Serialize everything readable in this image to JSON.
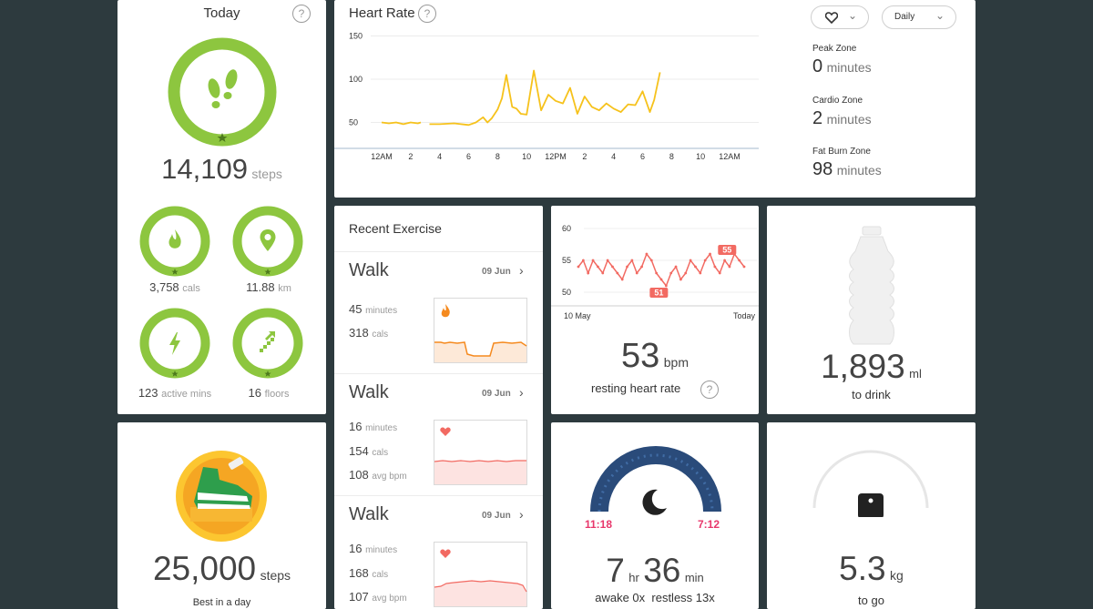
{
  "today": {
    "title": "Today",
    "help": "?",
    "steps_value": "14,109",
    "steps_unit": "steps",
    "cals_value": "3,758",
    "cals_unit": "cals",
    "km_value": "11.88",
    "km_unit": "km",
    "active_value": "123",
    "active_unit": "active mins",
    "floors_value": "16",
    "floors_unit": "floors"
  },
  "heart_rate": {
    "title": "Heart Rate",
    "help": "?",
    "period": "Daily",
    "zones": [
      {
        "label": "Peak Zone",
        "value": "0",
        "unit": "minutes"
      },
      {
        "label": "Cardio Zone",
        "value": "2",
        "unit": "minutes"
      },
      {
        "label": "Fat Burn Zone",
        "value": "98",
        "unit": "minutes"
      }
    ]
  },
  "chart_data": [
    {
      "type": "line",
      "x_tick_labels": [
        "12AM",
        "2",
        "4",
        "6",
        "8",
        "10",
        "12PM",
        "2",
        "4",
        "6",
        "8",
        "10",
        "12AM"
      ],
      "y_tick_labels": [
        "150",
        "100",
        "50"
      ],
      "ylim": [
        20,
        160
      ],
      "grid": true,
      "color": "#f6c21c",
      "series": [
        {
          "x": [
            0,
            0.5,
            1,
            1.5,
            2,
            2.5,
            2.7
          ],
          "y": [
            50,
            49,
            50,
            48,
            50,
            49,
            50
          ]
        },
        {
          "x": [
            3.3,
            4,
            5,
            6,
            6.5,
            7,
            7.3,
            7.6,
            8,
            8.3,
            8.6,
            9,
            9.3,
            9.6,
            10,
            10.5,
            11,
            11.5,
            12,
            12.5,
            13,
            13.5,
            14,
            14.5,
            15,
            15.5,
            16,
            16.5,
            17,
            17.5,
            18,
            18.5,
            18.8,
            19.2
          ],
          "y": [
            48,
            48,
            49,
            47,
            50,
            56,
            50,
            55,
            65,
            78,
            105,
            68,
            66,
            60,
            59,
            110,
            64,
            82,
            75,
            72,
            90,
            60,
            80,
            68,
            64,
            72,
            66,
            62,
            71,
            70,
            86,
            62,
            76,
            108
          ]
        }
      ]
    },
    {
      "type": "line",
      "x_tick_labels": [
        "10 May",
        "Today"
      ],
      "y_tick_labels": [
        "60",
        "55",
        "50"
      ],
      "ylim": [
        48,
        62
      ],
      "color": "#f26a62",
      "values": [
        54,
        55,
        53,
        55,
        54,
        53,
        55,
        54,
        53,
        52,
        54,
        55,
        53,
        54,
        56,
        55,
        53,
        52,
        51,
        53,
        54,
        52,
        53,
        55,
        54,
        53,
        55,
        56,
        54,
        53,
        55,
        54,
        56,
        55,
        54
      ],
      "annotations": [
        {
          "label": "51"
        },
        {
          "label": "55"
        }
      ]
    }
  ],
  "recent_exercise": {
    "title": "Recent Exercise",
    "items": [
      {
        "name": "Walk",
        "date": "09 Jun",
        "stats": [
          {
            "v": "45",
            "u": "minutes"
          },
          {
            "v": "318",
            "u": "cals"
          }
        ],
        "icon": "flame-icon"
      },
      {
        "name": "Walk",
        "date": "09 Jun",
        "stats": [
          {
            "v": "16",
            "u": "minutes"
          },
          {
            "v": "154",
            "u": "cals"
          },
          {
            "v": "108",
            "u": "avg bpm"
          }
        ],
        "icon": "heart-icon"
      },
      {
        "name": "Walk",
        "date": "09 Jun",
        "stats": [
          {
            "v": "16",
            "u": "minutes"
          },
          {
            "v": "168",
            "u": "cals"
          },
          {
            "v": "107",
            "u": "avg bpm"
          }
        ],
        "icon": "heart-icon"
      }
    ]
  },
  "resting": {
    "value": "53",
    "unit": "bpm",
    "label": "resting heart rate",
    "help": "?"
  },
  "water": {
    "value": "1,893",
    "unit": "ml",
    "label": "to drink"
  },
  "badge": {
    "value": "25,000",
    "unit": "steps",
    "label": "Best in a day"
  },
  "sleep": {
    "start": "11:18",
    "end": "7:12",
    "hours": "7",
    "hours_unit": "hr",
    "mins": "36",
    "mins_unit": "min",
    "awake": "awake 0x",
    "restless": "restless 13x"
  },
  "weight": {
    "value": "5.3",
    "unit": "kg",
    "label": "to go"
  },
  "colors": {
    "background": "#2d3a3e",
    "green": "#8dc63f",
    "yellow": "#f6c21c",
    "orange": "#f58a1f",
    "red": "#f26a62",
    "navy": "#2a4b7a",
    "pink": "#e8376b"
  }
}
